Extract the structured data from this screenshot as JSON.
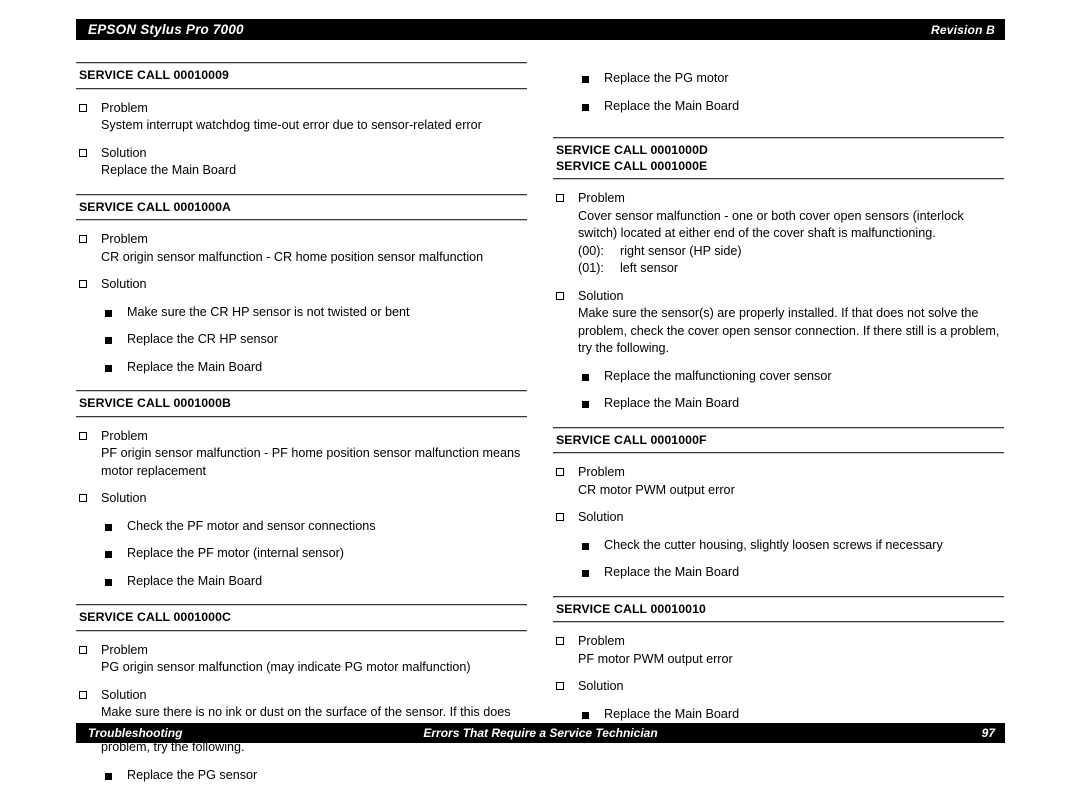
{
  "header": {
    "title": "EPSON Stylus Pro 7000",
    "revision": "Revision B"
  },
  "footer": {
    "left": "Troubleshooting",
    "center": "Errors That Require a Service Technician",
    "page": "97"
  },
  "labels": {
    "problem": "Problem",
    "solution": "Solution"
  },
  "columns": {
    "left": {
      "sections": [
        {
          "headings": [
            "SERVICE CALL 00010009"
          ],
          "problem_text": "System interrupt watchdog time-out error due to sensor-related error",
          "solution_text": "Replace the Main Board",
          "solution_items": []
        },
        {
          "headings": [
            "SERVICE CALL 0001000A"
          ],
          "problem_text": "CR origin sensor malfunction - CR home position sensor malfunction",
          "solution_text": "",
          "solution_items": [
            "Make sure the CR HP sensor is not twisted or bent",
            "Replace the CR HP sensor",
            "Replace the Main Board"
          ]
        },
        {
          "headings": [
            "SERVICE CALL 0001000B"
          ],
          "problem_text": "PF origin sensor malfunction - PF home position sensor malfunction means motor replacement",
          "solution_text": "",
          "solution_items": [
            "Check the PF motor and sensor connections",
            "Replace the PF motor (internal sensor)",
            "Replace the Main Board"
          ]
        },
        {
          "headings": [
            "SERVICE CALL 0001000C"
          ],
          "problem_text": "PG origin sensor malfunction (may indicate PG motor malfunction)",
          "solution_text": "Make sure there is no ink or dust on the surface of the sensor. If this does not solve the problem, check the PG sensor connection. If there still is a problem, try the following.",
          "solution_items": [
            "Replace the PG sensor"
          ]
        }
      ]
    },
    "right": {
      "continued_items": [
        "Replace the PG motor",
        "Replace the Main Board"
      ],
      "sections": [
        {
          "headings": [
            "SERVICE CALL 0001000D",
            "SERVICE CALL 0001000E"
          ],
          "problem_text": "Cover sensor malfunction - one or both cover open sensors (interlock switch) located at either end of the cover shaft is malfunctioning.",
          "problem_rows": [
            {
              "key": "(00):",
              "value": "right sensor (HP side)"
            },
            {
              "key": "(01):",
              "value": "left sensor"
            }
          ],
          "solution_text": "Make sure the sensor(s) are properly installed. If that does not solve the problem, check the cover open sensor connection. If there still is a problem, try the following.",
          "solution_items": [
            "Replace the malfunctioning cover sensor",
            "Replace the Main Board"
          ]
        },
        {
          "headings": [
            "SERVICE CALL 0001000F"
          ],
          "problem_text": "CR motor PWM output error",
          "solution_text": "",
          "solution_items": [
            "Check the cutter housing, slightly loosen screws if necessary",
            "Replace the Main Board"
          ]
        },
        {
          "headings": [
            "SERVICE CALL 00010010"
          ],
          "problem_text": "PF motor PWM output error",
          "solution_text": "",
          "solution_items": [
            "Replace the Main Board"
          ]
        }
      ]
    }
  }
}
